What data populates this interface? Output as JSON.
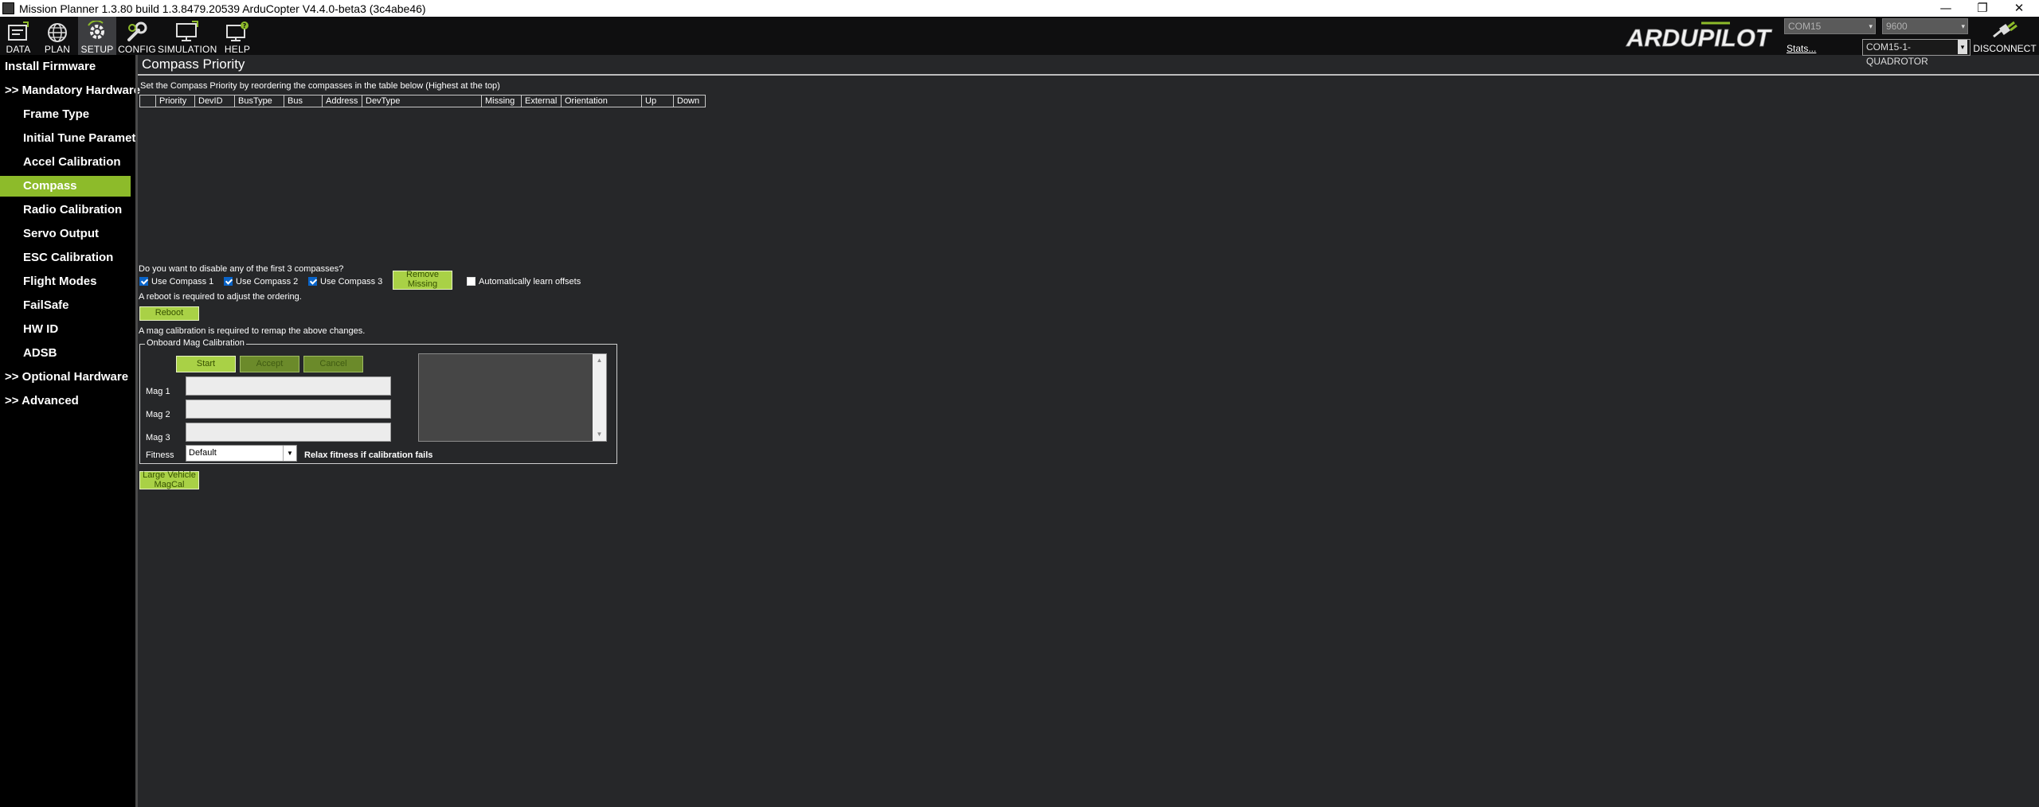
{
  "window": {
    "title": "Mission Planner 1.3.80 build 1.3.8479.20539 ArduCopter V4.4.0-beta3 (3c4abe46)",
    "minimize": "—",
    "restore": "❐",
    "close": "✕"
  },
  "toolbar": {
    "buttons": [
      {
        "label": "DATA",
        "icon": "data-icon"
      },
      {
        "label": "PLAN",
        "icon": "plan-globe-icon"
      },
      {
        "label": "SETUP",
        "icon": "setup-gear-icon",
        "active": true
      },
      {
        "label": "CONFIG",
        "icon": "config-wrench-icon"
      },
      {
        "label": "SIMULATION",
        "icon": "simulation-monitor-icon"
      },
      {
        "label": "HELP",
        "icon": "help-monitor-icon"
      }
    ],
    "logo_text": "ARDUPILOT",
    "port": "COM15",
    "baud": "9600",
    "stats_link": "Stats...",
    "connection": "COM15-1-QUADROTOR",
    "disconnect_label": "DISCONNECT"
  },
  "sidebar": {
    "items": [
      {
        "label": "Install Firmware"
      },
      {
        "label": ">> Mandatory Hardware"
      },
      {
        "label": "Frame Type"
      },
      {
        "label": "Initial Tune Parameters"
      },
      {
        "label": "Accel Calibration"
      },
      {
        "label": "Compass",
        "active": true
      },
      {
        "label": "Radio Calibration"
      },
      {
        "label": "Servo Output"
      },
      {
        "label": "ESC Calibration"
      },
      {
        "label": "Flight Modes"
      },
      {
        "label": "FailSafe"
      },
      {
        "label": "HW ID"
      },
      {
        "label": "ADSB"
      },
      {
        "label": ">> Optional Hardware"
      },
      {
        "label": ">> Advanced"
      }
    ]
  },
  "main": {
    "title": "Compass Priority",
    "instructions": "Set the Compass Priority by reordering the compasses in the table below (Highest at the top)",
    "table_columns": [
      "",
      "Priority",
      "DevID",
      "BusType",
      "Bus",
      "Address",
      "DevType",
      "Missing",
      "External",
      "Orientation",
      "Up",
      "Down"
    ],
    "disable_question": "Do you want to disable any of the first 3 compasses?",
    "use_compass_1": "Use Compass 1",
    "use_compass_2": "Use Compass 2",
    "use_compass_3": "Use Compass 3",
    "remove_missing": "Remove Missing",
    "auto_learn": "Automatically learn offsets",
    "reboot_note": "A reboot is required to adjust the ordering.",
    "reboot_button": "Reboot",
    "remap_note": "A mag calibration is required to remap the above changes.",
    "onboard": {
      "legend": "Onboard Mag Calibration",
      "start": "Start",
      "accept": "Accept",
      "cancel": "Cancel",
      "mag1": "Mag 1",
      "mag2": "Mag 2",
      "mag3": "Mag 3",
      "fitness_label": "Fitness",
      "fitness_value": "Default",
      "relax": "Relax fitness if calibration fails"
    },
    "large_vehicle": "Large Vehicle MagCal"
  },
  "colors": {
    "accent_green": "#8dbb2a",
    "button_green": "#a9d146",
    "background": "#262729",
    "sidebar": "#000000"
  }
}
